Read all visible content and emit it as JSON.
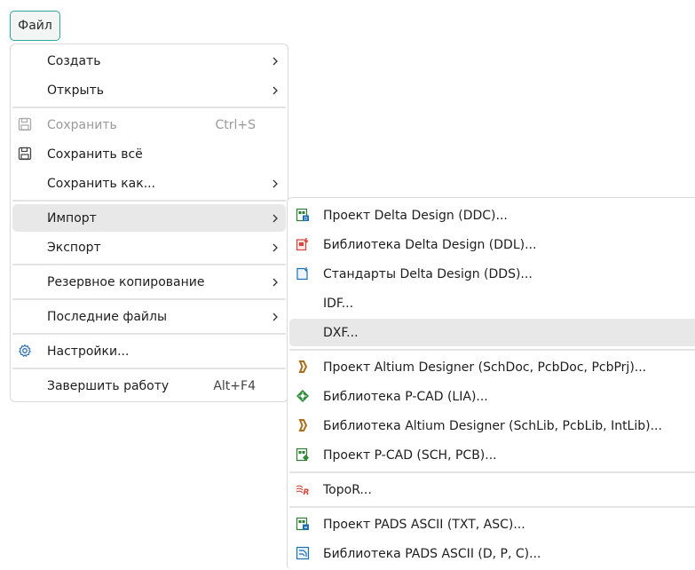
{
  "menubar": {
    "file_label": "Файл"
  },
  "colors": {
    "accent": "#2aa79a",
    "highlight": "#e8e8e8",
    "separator": "#e3e3e3",
    "disabled": "#9a9a9a"
  },
  "file_menu": {
    "create": "Создать",
    "open": "Открыть",
    "save": "Сохранить",
    "save_shortcut": "Ctrl+S",
    "save_all": "Сохранить всё",
    "save_as": "Сохранить как...",
    "import": "Импорт",
    "export": "Экспорт",
    "backup": "Резервное копирование",
    "recent": "Последние файлы",
    "settings": "Настройки...",
    "exit": "Завершить работу",
    "exit_shortcut": "Alt+F4"
  },
  "import_menu": {
    "ddc": "Проект Delta Design (DDC)...",
    "ddl": "Библиотека Delta Design (DDL)...",
    "dds": "Стандарты Delta Design (DDS)...",
    "idf": "IDF...",
    "dxf": "DXF...",
    "altium_project": "Проект Altium Designer (SchDoc, PcbDoc, PcbPrj)...",
    "pcad_lib": "Библиотека P-CAD (LIA)...",
    "altium_lib": "Библиотека Altium Designer (SchLib, PcbLib, IntLib)...",
    "pcad_project": "Проект P-CAD (SCH, PCB)...",
    "topor": "TopoR...",
    "pads_project": "Проект PADS ASCII (TXT, ASC)...",
    "pads_lib": "Библиотека PADS ASCII (D, P, C)..."
  },
  "icons": {
    "save": "floppy-disk-icon",
    "save_all": "floppy-disk-icon",
    "settings": "gear-icon",
    "submenu": "chevron-right-icon"
  }
}
